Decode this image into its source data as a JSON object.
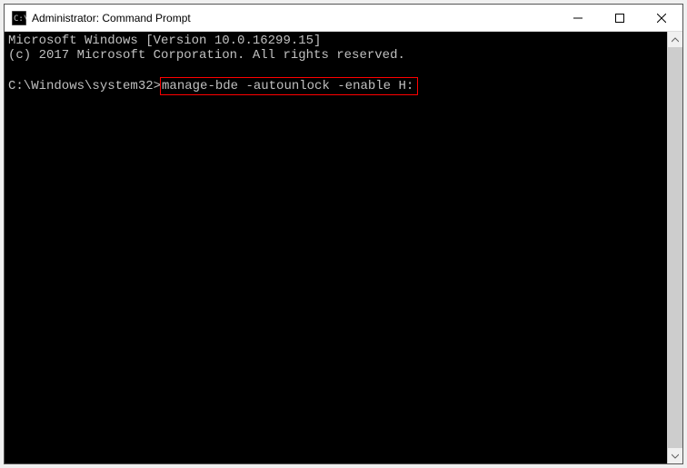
{
  "window": {
    "title": "Administrator: Command Prompt"
  },
  "console": {
    "line1": "Microsoft Windows [Version 10.0.16299.15]",
    "line2": "(c) 2017 Microsoft Corporation. All rights reserved.",
    "blank": "",
    "promptPath": "C:\\Windows\\system32>",
    "command": "manage-bde -autounlock -enable H:"
  }
}
